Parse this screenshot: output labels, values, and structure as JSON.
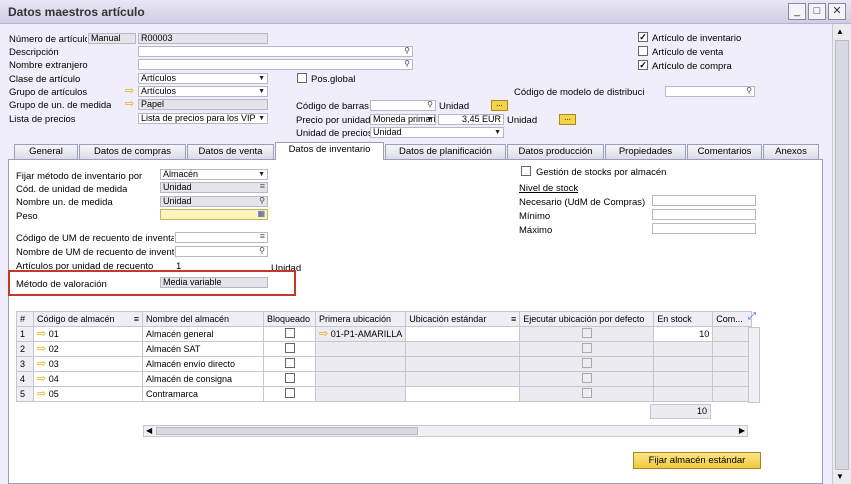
{
  "window": {
    "title": "Datos maestros artículo"
  },
  "header": {
    "item_no_label": "Número de artículo",
    "item_no_series": "Manual",
    "item_no_value": "R00003",
    "description_label": "Descripción",
    "foreign_name_label": "Nombre extranjero",
    "item_class_label": "Clase de artículo",
    "item_class_value": "Artículos",
    "item_group_label": "Grupo de artículos",
    "item_group_value": "Artículos",
    "uom_group_label": "Grupo de un. de medida",
    "uom_group_value": "Papel",
    "price_list_label": "Lista de precios",
    "price_list_value": "Lista de precios para los VIP",
    "pos_global_label": "Pos.global",
    "barcode_label": "Código de barras",
    "barcode_unit": "Unidad",
    "unit_price_label": "Precio por unidad",
    "unit_price_currency": "Moneda primaria",
    "unit_price_value": "3,45 EUR",
    "unit_price_unit": "Unidad",
    "price_unit_label": "Unidad de precios",
    "price_unit_value": "Unidad",
    "inventory_item_label": "Artículo de inventario",
    "sales_item_label": "Artículo de venta",
    "purchase_item_label": "Artículo de compra",
    "inventory_item_checked": "✓",
    "sales_item_checked": "",
    "purchase_item_checked": "✓",
    "distribution_model_label": "Código de modelo de distribución"
  },
  "tabs": [
    "General",
    "Datos de compras",
    "Datos de venta",
    "Datos de inventario",
    "Datos de planificación",
    "Datos producción",
    "Propiedades",
    "Comentarios",
    "Anexos"
  ],
  "inventory": {
    "set_method_label": "Fijar método de inventario por",
    "set_method_value": "Almacén",
    "uom_code_label": "Cód. de unidad de medida",
    "uom_code_value": "Unidad",
    "uom_name_label": "Nombre un. de medida",
    "uom_name_value": "Unidad",
    "weight_label": "Peso",
    "count_uom_code_label": "Código de UM de recuento de inventario",
    "count_uom_name_label": "Nombre de UM de recuento de inventario",
    "items_per_count_label": "Artículos por unidad de recuento",
    "items_per_count_value": "1",
    "items_per_count_unit": "Unidad",
    "valuation_label": "Método de valoración",
    "valuation_value": "Media variable",
    "manage_by_wh_label": "Gestión de stocks por almacén",
    "stock_level_label": "Nivel de stock",
    "required_label": "Necesario (UdM de Compras)",
    "min_label": "Mínimo",
    "max_label": "Máximo"
  },
  "grid": {
    "columns": [
      "#",
      "Código de almacén",
      "Nombre del almacén",
      "Bloqueado",
      "Primera ubicación",
      "Ubicación estándar",
      "Ejecutar ubicación por defecto",
      "En stock",
      "Com..."
    ],
    "rows": [
      {
        "n": "1",
        "code": "01",
        "name": "Almacén general",
        "first_bin": "01-P1-AMARILLA",
        "stock": "10"
      },
      {
        "n": "2",
        "code": "02",
        "name": "Almacén SAT",
        "first_bin": "",
        "stock": ""
      },
      {
        "n": "3",
        "code": "03",
        "name": "Almacén envío directo",
        "first_bin": "",
        "stock": ""
      },
      {
        "n": "4",
        "code": "04",
        "name": "Almacén de consigna",
        "first_bin": "",
        "stock": ""
      },
      {
        "n": "5",
        "code": "05",
        "name": "Contramarca",
        "first_bin": "",
        "stock": ""
      }
    ],
    "total_stock": "10"
  },
  "buttons": {
    "set_default_wh": "Fijar almacén estándar",
    "dots": "..."
  }
}
